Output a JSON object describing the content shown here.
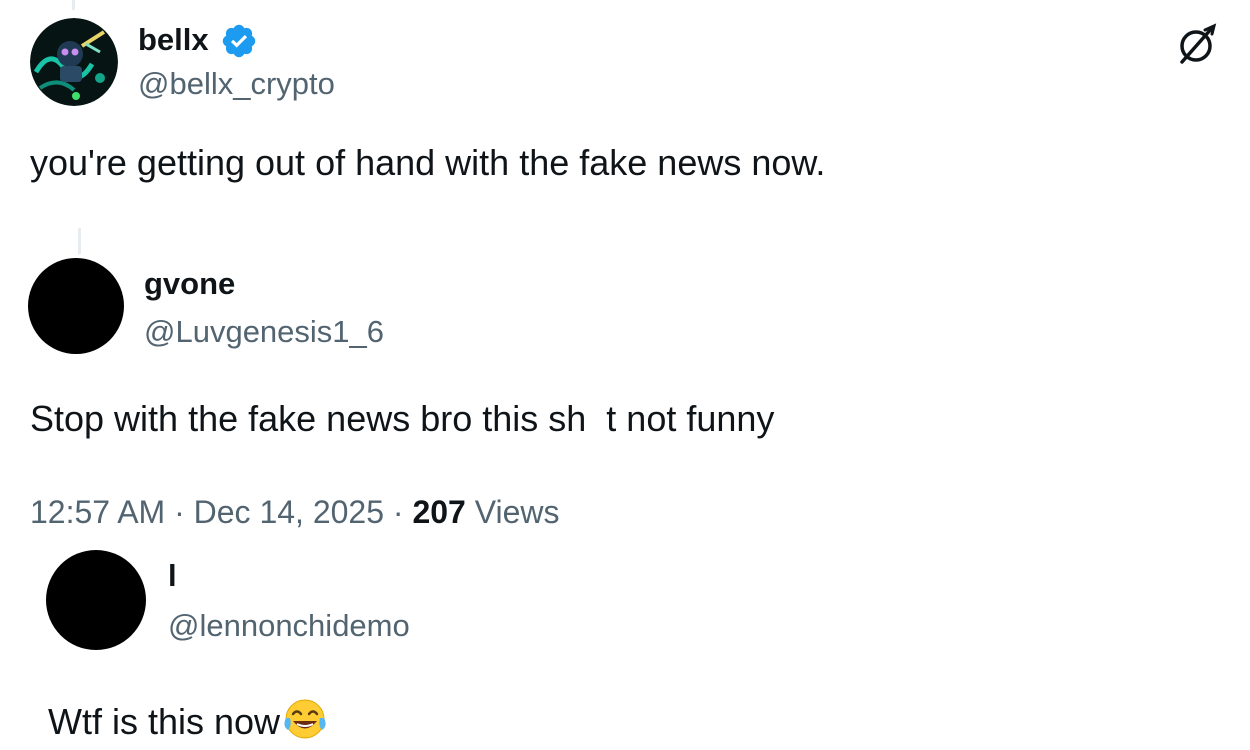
{
  "colors": {
    "text_primary": "#0f1419",
    "text_secondary": "#536471",
    "verified_blue": "#1d9bf0"
  },
  "original_post": {
    "display_name": "bellx",
    "handle": "@bellx_crypto",
    "verified": true,
    "text": "you're getting out of hand with the fake news now.",
    "corner_icon": "grok-icon"
  },
  "quoted_post": {
    "display_name": "gvone",
    "handle": "@Luvgenesis1_6",
    "text": "Stop with the fake news bro this sh  t not funny"
  },
  "post_meta": {
    "time": "12:57 AM",
    "separator": "·",
    "date": "Dec 14, 2025",
    "views_count": "207",
    "views_label": "Views"
  },
  "reply": {
    "display_name": "l",
    "handle": "@lennonchidemo",
    "text": "Wtf is this now",
    "emoji": "face-with-tears-of-joy"
  }
}
